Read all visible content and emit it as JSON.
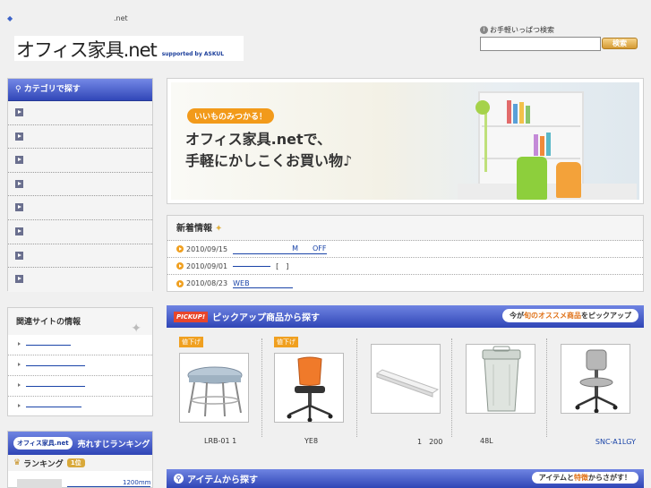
{
  "header": {
    "tagline": ".net",
    "logo_main": "オフィス家具.net",
    "logo_sub": "supported by ASKUL",
    "search_label": "お手軽いっぱつ検索",
    "search_value": "",
    "search_button": "検索"
  },
  "category": {
    "title": "カテゴリで探す",
    "items": [
      "",
      "",
      "",
      "",
      "",
      "",
      "",
      ""
    ]
  },
  "related": {
    "title": "関連サイトの情報",
    "items": [
      "",
      "",
      "",
      ""
    ]
  },
  "ranking": {
    "logo": "オフィス家具.net",
    "title": "売れすじランキング",
    "sub": "ランキング",
    "badge": "1位",
    "item_link": "1200mm"
  },
  "banner": {
    "pill": "いいものみつかる！",
    "line1": "オフィス家具.netで、",
    "line2": "手軽にかしこくお買い物♪"
  },
  "news": {
    "title": "新着情報",
    "rows": [
      {
        "date": "2010/09/15",
        "text": "M　　OFF"
      },
      {
        "date": "2010/09/01",
        "text": "[　]"
      },
      {
        "date": "2010/08/23",
        "text": "WEB"
      }
    ]
  },
  "pickup": {
    "badge": "PICKUP!",
    "title": "ピックアップ商品から探す",
    "right_pre": "今が",
    "right_acc": "旬のオススメ商品",
    "right_post": "をピックアップ",
    "products": [
      {
        "tag": "値下げ",
        "code": "LRB-01 1"
      },
      {
        "tag": "値下げ",
        "code": "YE8"
      },
      {
        "tag": "",
        "code": "1　200"
      },
      {
        "tag": "",
        "code": "48L"
      },
      {
        "tag": "",
        "code": "SNC-A1LGY"
      }
    ]
  },
  "items_section": {
    "title": "アイテムから探す",
    "right_pre": "アイテムと",
    "right_acc": "特徴",
    "right_post": "からさがす！"
  },
  "colors": {
    "nav_blue": "#3147b8",
    "accent_orange": "#f0a020",
    "link": "#1a44a8"
  }
}
